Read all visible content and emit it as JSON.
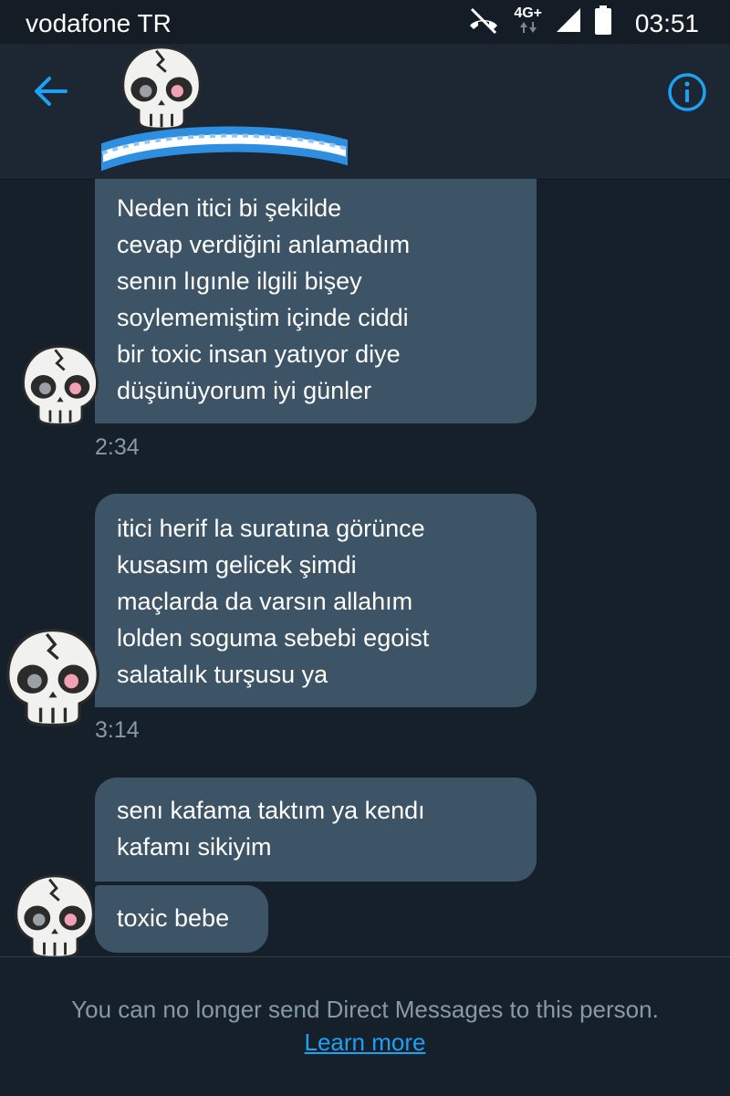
{
  "status_bar": {
    "carrier": "vodafone TR",
    "network": "4G+",
    "time": "03:51"
  },
  "header": {
    "back_icon": "arrow-left-icon",
    "info_icon": "info-circle-icon",
    "accent_color": "#1da1f2"
  },
  "messages": [
    {
      "lines": [
        "Neden itici bi şekilde",
        "cevap verdiğini anlamadım",
        "senın lıgınle ilgili bişey",
        "soylememiştim içinde ciddi",
        "bir toxic insan yatıyor diye",
        "düşünüyorum iyi günler"
      ],
      "time": "2:34"
    },
    {
      "lines": [
        "itici herif la suratına görünce",
        "kusasım gelicek şimdi",
        "maçlarda da varsın allahım",
        "lolden soguma sebebi egoist",
        "salatalık turşusu ya"
      ],
      "time": "3:14"
    },
    {
      "lines": [
        "senı kafama taktım ya kendı",
        "kafamı sikiyim"
      ]
    },
    {
      "lines": [
        "toxic bebe"
      ]
    }
  ],
  "footer": {
    "notice": "You can no longer send Direct Messages to this person.",
    "link": "Learn more"
  },
  "colors": {
    "background": "#15202b",
    "bubble": "#3d5466",
    "meta_text": "#8899a6",
    "link": "#1da1f2"
  }
}
